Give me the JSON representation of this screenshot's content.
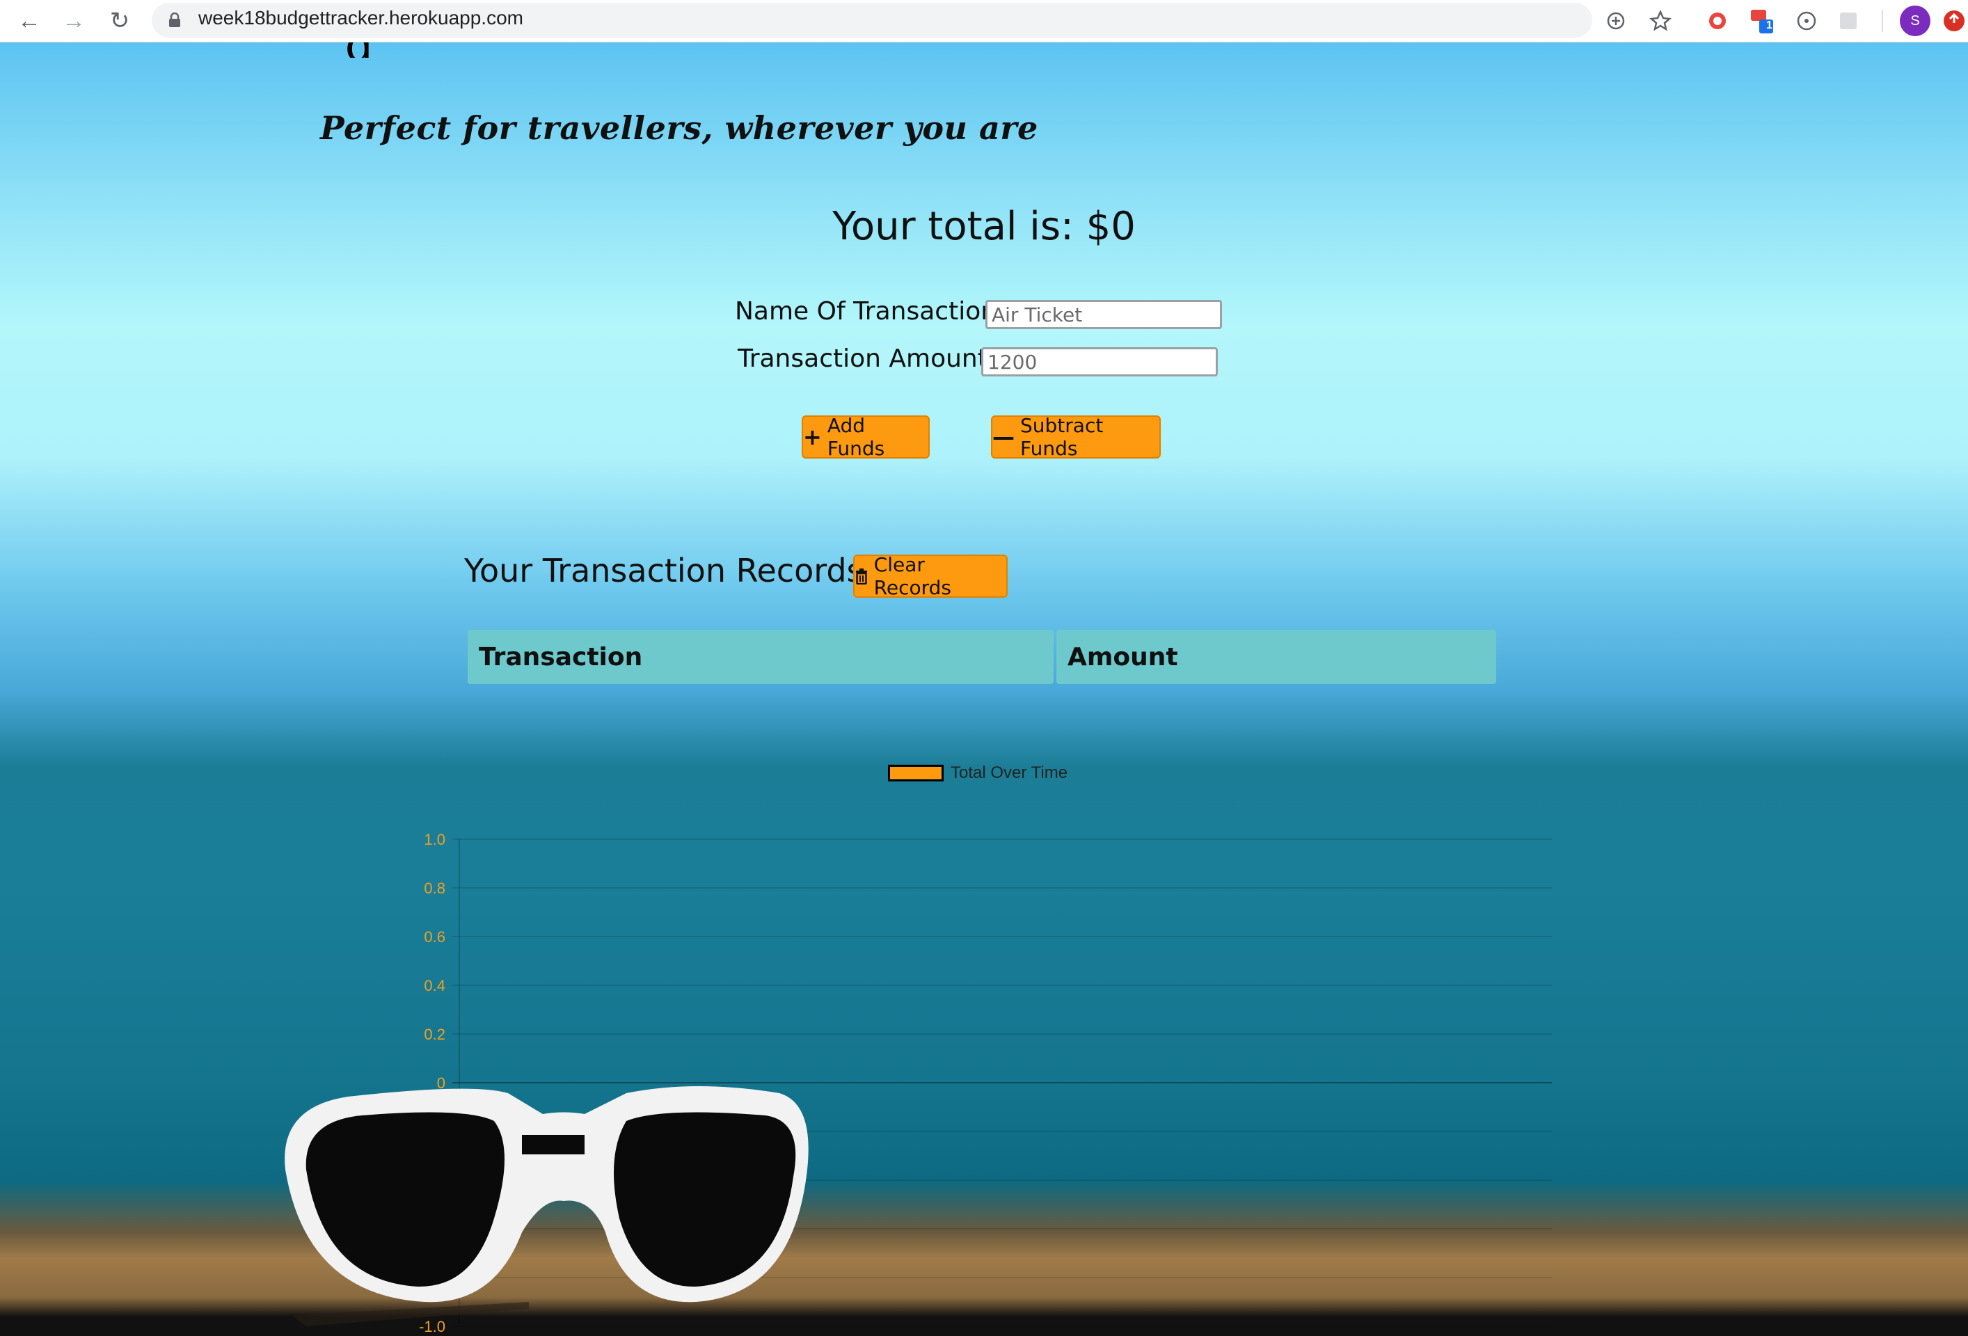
{
  "browser": {
    "url": "week18budgettracker.herokuapp.com",
    "profile_initial": "S",
    "extension_badge": "1"
  },
  "page": {
    "heading_partial": "g",
    "tagline": "Perfect for travellers, wherever you are",
    "total_text": "Your total is: $0",
    "form": {
      "name_label": "Name Of Transaction:",
      "name_placeholder": "Air Ticket",
      "amount_label": "Transaction Amount:",
      "amount_placeholder": "1200"
    },
    "buttons": {
      "add_label": "Add Funds",
      "add_icon": "plus-icon",
      "subtract_label": "Subtract Funds",
      "subtract_icon": "minus-icon",
      "clear_label": "Clear Records",
      "clear_icon": "trash-icon"
    },
    "records_title": "Your Transaction Records",
    "table_headers": [
      "Transaction",
      "Amount"
    ]
  },
  "colors": {
    "accent": "#fd9a0f",
    "table_header": "#6dc9cc",
    "tick_labels": "#f0a020"
  },
  "chart_data": {
    "type": "line",
    "series": [
      {
        "name": "Total Over Time",
        "values": []
      }
    ],
    "categories": [],
    "ylim": [
      -1.0,
      1.0
    ],
    "yticks": [
      "1.0",
      "0.8",
      "0.6",
      "0.4",
      "0.2",
      "0",
      "-0.2",
      "-0.4",
      "-0.6",
      "-0.8",
      "-1.0"
    ],
    "grid": true,
    "legend": "top-center"
  }
}
